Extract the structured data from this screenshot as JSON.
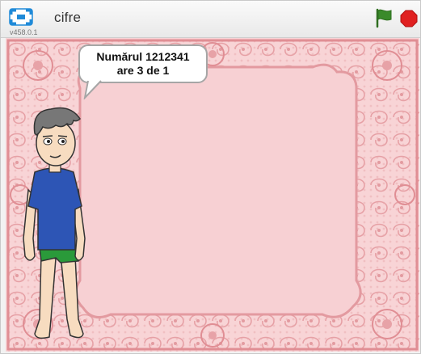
{
  "window": {
    "title": "cifre",
    "version": "v458.0.1"
  },
  "toolbar": {
    "fullscreen_icon": "fullscreen-icon",
    "green_flag_icon": "green-flag-icon",
    "stop_icon": "stop-sign-icon"
  },
  "stage": {
    "backdrop": "pink-lace-frame",
    "speech_bubble": {
      "line1": "Numărul 1212341",
      "line2": "are 3 de 1"
    },
    "sprite": "boy"
  },
  "colors": {
    "flag": "#3a8a2a",
    "stop": "#e02020",
    "fullscreen": "#1f8ad8",
    "backdrop": "#f6c8ca",
    "lace": "#e49aa0"
  }
}
